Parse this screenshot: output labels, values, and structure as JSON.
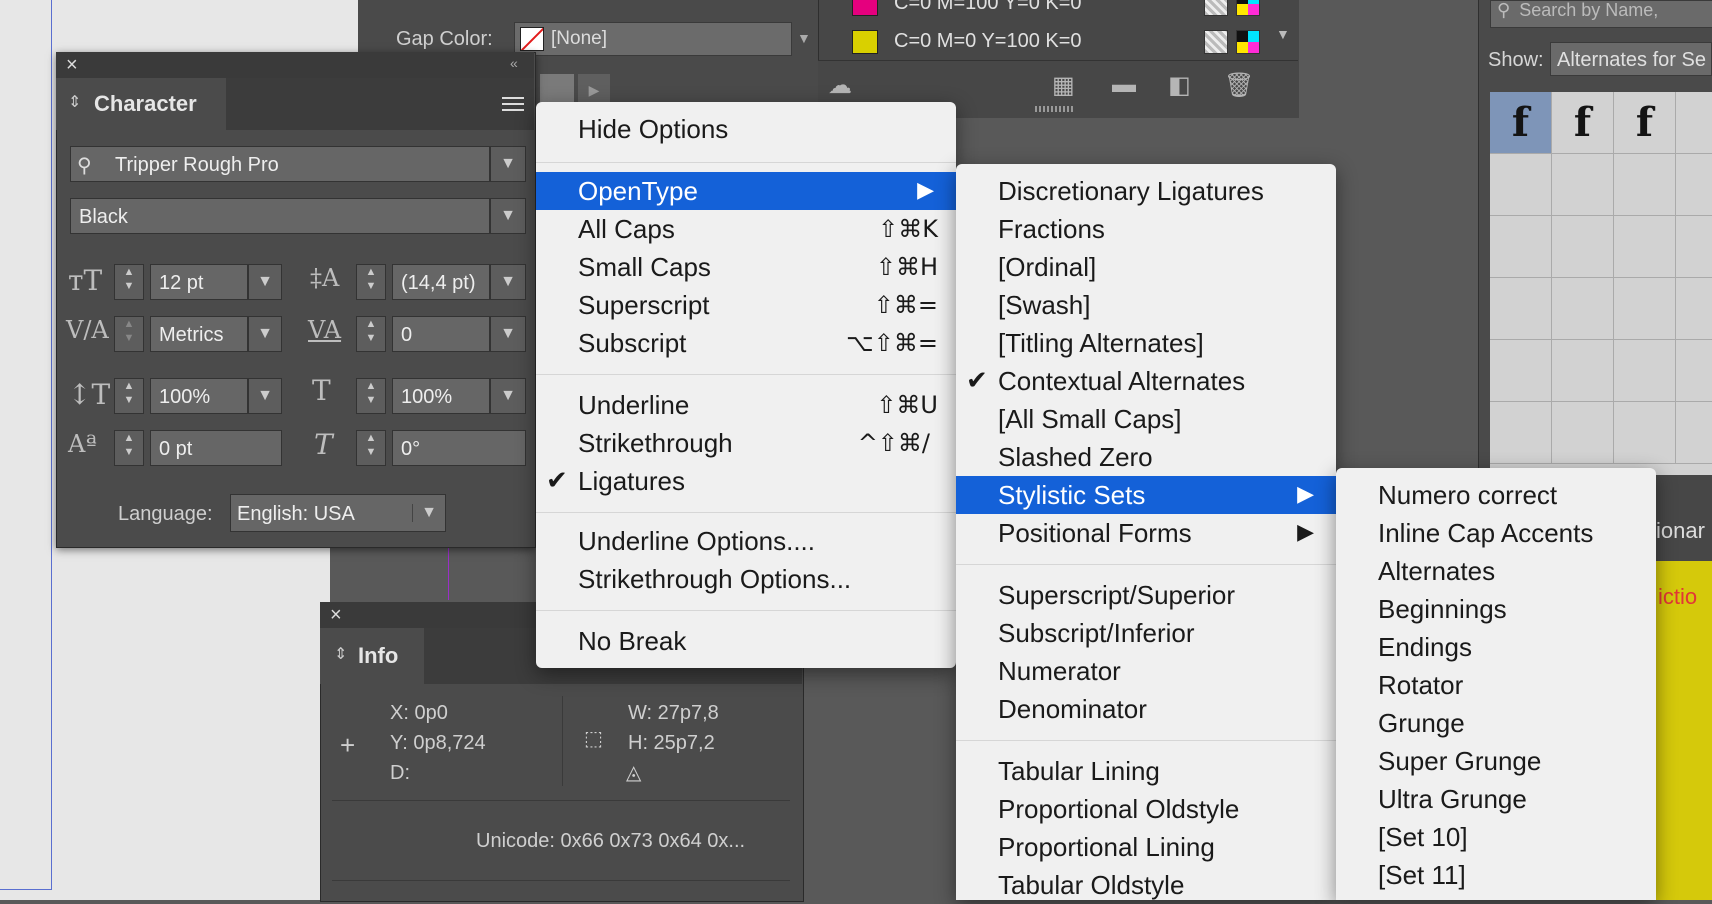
{
  "stroke": {
    "gap_color_label": "Gap Color:",
    "gap_color_value": "[None]"
  },
  "swatches": {
    "rows": [
      {
        "name": "C=0 M=100 Y=0 K=0",
        "color": "#e5007e"
      },
      {
        "name": "C=0 M=0 Y=100 K=0",
        "color": "#ffe500"
      }
    ]
  },
  "glyphs": {
    "search_placeholder": "Search by Name,",
    "show_label": "Show:",
    "show_value": "Alternates for Se",
    "glyph_cells": [
      "f",
      "f",
      "f"
    ],
    "selected_cell_color": "#7e95b8"
  },
  "dict_panel": {
    "header_partial": "ionar",
    "content_partial": "ictio"
  },
  "character": {
    "tab": "Character",
    "font_family": "Tripper Rough Pro",
    "font_style": "Black",
    "font_size": "12 pt",
    "leading": "(14,4 pt)",
    "kerning": "Metrics",
    "tracking": "0",
    "vertical_scale": "100%",
    "horizontal_scale": "100%",
    "baseline_shift": "0 pt",
    "skew": "0°",
    "language_label": "Language:",
    "language": "English: USA"
  },
  "info": {
    "tab": "Info",
    "x": "X: 0p0",
    "y": "Y: 0p8,724",
    "d": "D:",
    "w": "W: 27p7,8",
    "h": "H: 25p7,2",
    "unicode": "Unicode: 0x66 0x73 0x64 0x..."
  },
  "menu_main": {
    "hide_options": "Hide Options",
    "opentype": "OpenType",
    "items": [
      {
        "label": "All Caps",
        "shortcut": "⇧⌘K"
      },
      {
        "label": "Small Caps",
        "shortcut": "⇧⌘H"
      },
      {
        "label": "Superscript",
        "shortcut": "⇧⌘="
      },
      {
        "label": "Subscript",
        "shortcut": "⌥⇧⌘="
      }
    ],
    "items2": [
      {
        "label": "Underline",
        "shortcut": "⇧⌘U"
      },
      {
        "label": "Strikethrough",
        "shortcut": "^⇧⌘/"
      },
      {
        "label": "Ligatures",
        "shortcut": "",
        "checked": true
      }
    ],
    "underline_options": "Underline Options....",
    "strikethrough_options": "Strikethrough Options...",
    "no_break": "No Break",
    "highlight_color": "#1461d8"
  },
  "menu_opentype": {
    "group1": [
      "Discretionary Ligatures",
      "Fractions",
      "[Ordinal]",
      "[Swash]",
      "[Titling Alternates]",
      "Contextual Alternates",
      "[All Small Caps]",
      "Slashed Zero"
    ],
    "checked_index": 5,
    "stylistic_sets": "Stylistic Sets",
    "positional_forms": "Positional Forms",
    "group2": [
      "Superscript/Superior",
      "Subscript/Inferior",
      "Numerator",
      "Denominator"
    ],
    "group3": [
      "Tabular Lining",
      "Proportional Oldstyle",
      "Proportional Lining",
      "Tabular Oldstyle"
    ]
  },
  "menu_stylistic": {
    "items": [
      "Numero correct",
      "Inline Cap Accents",
      "Alternates",
      "Beginnings",
      "Endings",
      "Rotator",
      "Grunge",
      "Super Grunge",
      "Ultra Grunge",
      "[Set 10]",
      "[Set 11]"
    ]
  }
}
